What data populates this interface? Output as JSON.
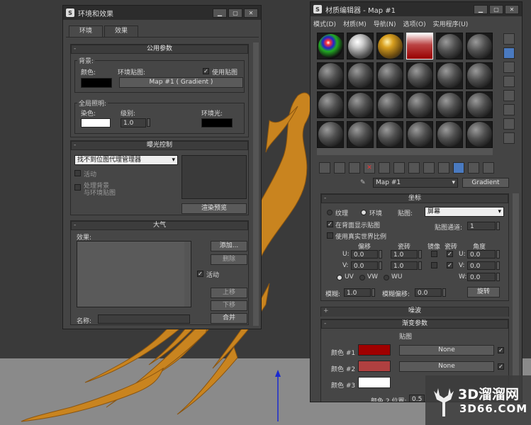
{
  "env": {
    "title": "环境和效果",
    "tabs": [
      "环境",
      "效果"
    ],
    "common": {
      "header": "公用参数",
      "bg_group": "背景:",
      "color_label": "颜色:",
      "env_map_label": "环境贴图:",
      "use_map_label": "使用贴图",
      "map_button": "Map #1  ( Gradient )",
      "global_group": "全局照明:",
      "tint_label": "染色:",
      "level_label": "级别:",
      "level_value": "1.0",
      "ambient_label": "环境光:"
    },
    "exposure": {
      "header": "曝光控制",
      "dropdown": "找不到位图代理管理器",
      "active": "活动",
      "process_bg": "处理背景",
      "and_env": "与环境贴图",
      "render_preview": "渲染预览"
    },
    "atmos": {
      "header": "大气",
      "effects_label": "效果:",
      "add": "添加...",
      "delete": "删除",
      "active": "活动",
      "move_up": "上移",
      "move_down": "下移",
      "name_label": "名称:",
      "merge": "合并"
    }
  },
  "mat": {
    "title": "材质编辑器 - Map #1",
    "menu": [
      "模式(D)",
      "材质(M)",
      "导航(N)",
      "选项(O)",
      "实用程序(U)"
    ],
    "map_name": "Map #1",
    "map_type": "Gradient",
    "coords": {
      "header": "坐标",
      "texture": "纹理",
      "environ": "环境",
      "mapping_label": "贴图:",
      "mapping_value": "屏幕",
      "show_back": "在背面显示贴图",
      "map_channel_label": "贴图通道:",
      "map_channel_value": "1",
      "real_world": "使用真实世界比例",
      "col_offset": "偏移",
      "col_tiling": "瓷砖",
      "col_mirror": "镜像",
      "col_tile": "瓷砖",
      "col_angle": "角度",
      "u_label": "U:",
      "v_label": "V:",
      "w_label": "W:",
      "u_offset": "0.0",
      "u_tiling": "1.0",
      "v_offset": "0.0",
      "v_tiling": "1.0",
      "u_angle": "0.0",
      "v_angle": "0.0",
      "w_angle": "0.0",
      "uv": "UV",
      "vw": "VW",
      "wu": "WU",
      "blur_label": "模糊:",
      "blur_value": "1.0",
      "blur_offset_label": "模糊偏移:",
      "blur_offset_value": "0.0",
      "rotate": "旋转"
    },
    "noise": {
      "header": "噪波"
    },
    "gradient": {
      "header": "渐变参数",
      "map_col": "贴图",
      "color1": "颜色 #1",
      "color2": "颜色 #2",
      "color3": "颜色 #3",
      "none": "None",
      "color2_pos_label": "颜色 2 位置:",
      "color2_pos_value": "0.5"
    }
  },
  "watermark": {
    "site": "3D溜溜网",
    "url": "3D66.COM"
  },
  "colors": {
    "accent_red": "#a00000",
    "mid_red": "#b04040",
    "phoenix": "#c9841f"
  }
}
